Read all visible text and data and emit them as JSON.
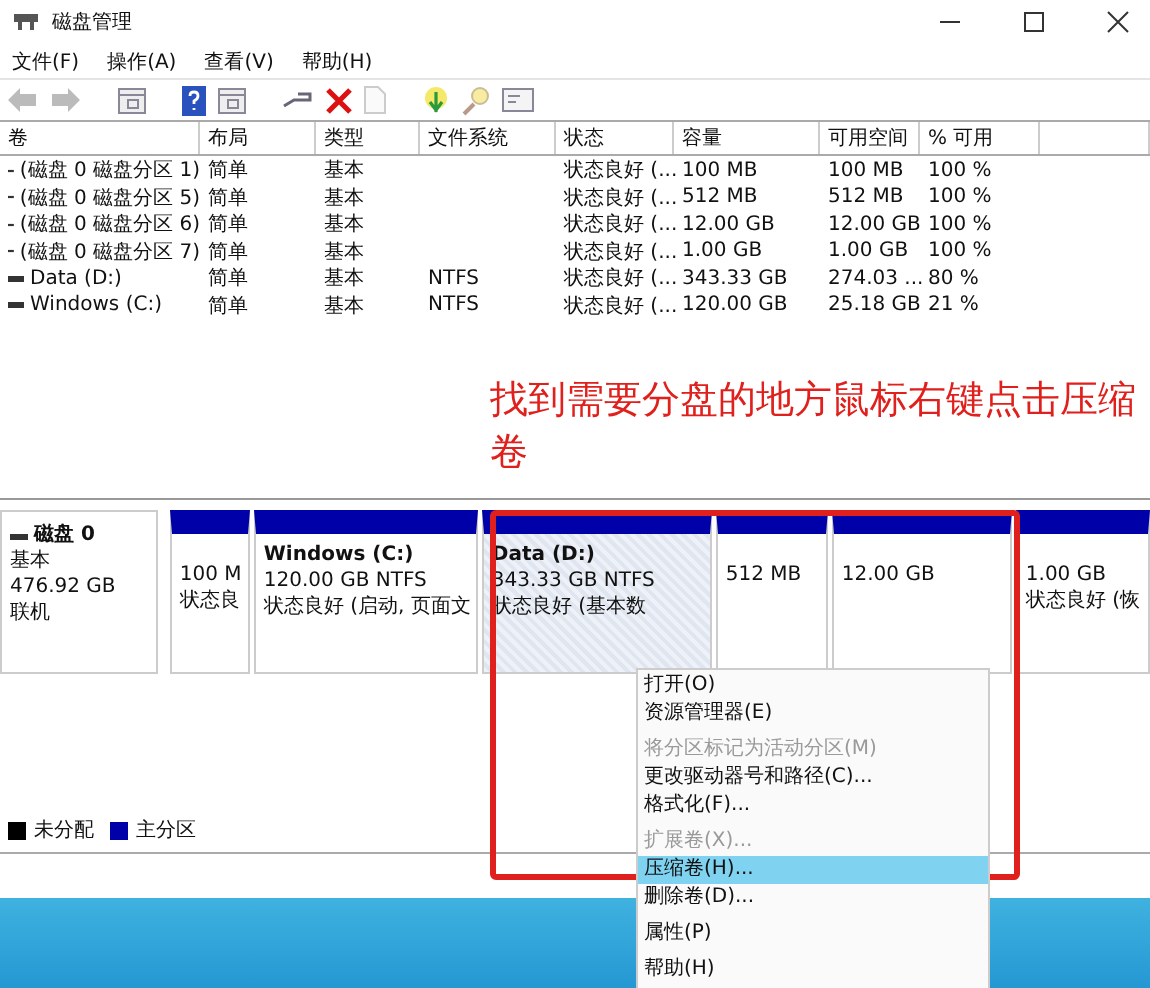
{
  "window": {
    "title": "磁盘管理"
  },
  "menu": [
    "文件(F)",
    "操作(A)",
    "查看(V)",
    "帮助(H)"
  ],
  "toolbar": [
    {
      "kind": "back",
      "disabled": true
    },
    {
      "kind": "forward",
      "disabled": true
    },
    {
      "kind": "panel",
      "disabled": false
    },
    {
      "kind": "help",
      "disabled": false
    },
    {
      "kind": "panel",
      "disabled": false
    },
    {
      "kind": "connect",
      "disabled": false
    },
    {
      "kind": "delete",
      "disabled": false
    },
    {
      "kind": "page",
      "disabled": true
    },
    {
      "kind": "up",
      "disabled": false
    },
    {
      "kind": "search",
      "disabled": false
    },
    {
      "kind": "window",
      "disabled": false
    }
  ],
  "table": {
    "columns": [
      "卷",
      "布局",
      "类型",
      "文件系统",
      "状态",
      "容量",
      "可用空间",
      "% 可用"
    ],
    "rows": [
      [
        "(磁盘 0 磁盘分区 1)",
        "简单",
        "基本",
        null,
        "状态良好 (...",
        "100 MB",
        "100 MB",
        "100 %"
      ],
      [
        "(磁盘 0 磁盘分区 5)",
        "简单",
        "基本",
        null,
        "状态良好 (...",
        "512 MB",
        "512 MB",
        "100 %"
      ],
      [
        "(磁盘 0 磁盘分区 6)",
        "简单",
        "基本",
        null,
        "状态良好 (...",
        "12.00 GB",
        "12.00 GB",
        "100 %"
      ],
      [
        "(磁盘 0 磁盘分区 7)",
        "简单",
        "基本",
        null,
        "状态良好 (...",
        "1.00 GB",
        "1.00 GB",
        "100 %"
      ],
      [
        "Data (D:)",
        "简单",
        "基本",
        "NTFS",
        "状态良好 (...",
        "343.33 GB",
        "274.03 ...",
        "80 %"
      ],
      [
        "Windows (C:)",
        "简单",
        "基本",
        "NTFS",
        "状态良好 (...",
        "120.00 GB",
        "25.18 GB",
        "21 %"
      ]
    ]
  },
  "annotation": "找到需要分盘的地方鼠标右键点击压缩卷",
  "disk": {
    "name": "磁盘 0",
    "type": "基本",
    "size": "476.92 GB",
    "status": "联机",
    "partitions": [
      {
        "size": "100 M",
        "status": "状态良",
        "selected": false
      },
      {
        "name": "Windows (C:)",
        "size": "120.00 GB NTFS",
        "status": "状态良好 (启动, 页面文",
        "selected": false
      },
      {
        "name": "Data (D:)",
        "size": "343.33 GB NTFS",
        "status": "状态良好 (基本数",
        "selected": true
      },
      {
        "size": "512 MB",
        "selected": false
      },
      {
        "size": "12.00 GB",
        "selected": false
      },
      {
        "size": "1.00 GB",
        "status": "状态良好 (恢",
        "selected": false
      }
    ]
  },
  "legend": [
    {
      "label": "未分配",
      "color": "#000000"
    },
    {
      "label": "主分区",
      "color": "#0000a8"
    }
  ],
  "context_menu": [
    {
      "kind": "item",
      "label": "打开(O)",
      "disabled": false,
      "selected": false
    },
    {
      "kind": "item",
      "label": "资源管理器(E)",
      "disabled": false,
      "selected": false
    },
    {
      "kind": "separator"
    },
    {
      "kind": "item",
      "label": "将分区标记为活动分区(M)",
      "disabled": true,
      "selected": false
    },
    {
      "kind": "item",
      "label": "更改驱动器号和路径(C)...",
      "disabled": false,
      "selected": false
    },
    {
      "kind": "item",
      "label": "格式化(F)...",
      "disabled": false,
      "selected": false
    },
    {
      "kind": "separator"
    },
    {
      "kind": "item",
      "label": "扩展卷(X)...",
      "disabled": true,
      "selected": false
    },
    {
      "kind": "item",
      "label": "压缩卷(H)...",
      "disabled": false,
      "selected": true
    },
    {
      "kind": "item",
      "label": "删除卷(D)...",
      "disabled": false,
      "selected": false
    },
    {
      "kind": "separator"
    },
    {
      "kind": "item",
      "label": "属性(P)",
      "disabled": false,
      "selected": false
    },
    {
      "kind": "separator"
    },
    {
      "kind": "item",
      "label": "帮助(H)",
      "disabled": false,
      "selected": false
    }
  ]
}
